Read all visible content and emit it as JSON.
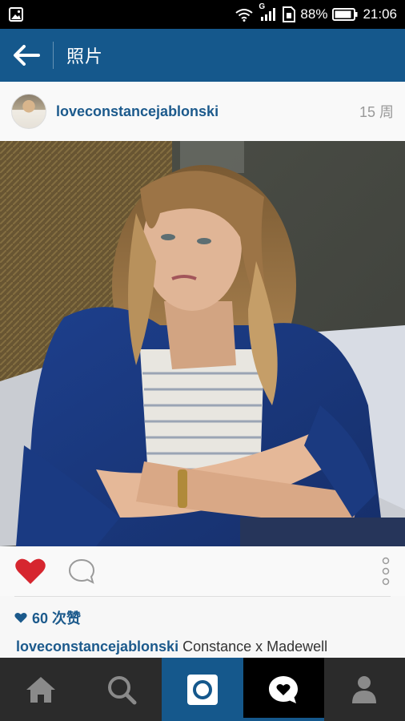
{
  "status_bar": {
    "battery": "88%",
    "time": "21:06",
    "network_label": "G"
  },
  "header": {
    "title": "照片",
    "back_icon": "arrow-left-icon"
  },
  "post": {
    "username": "loveconstancejablonski",
    "time_ago": "15 周",
    "likes": "60 次赞",
    "caption_user": "loveconstancejablonski",
    "caption_text": " Constance x Madewell",
    "liked": true
  },
  "nav": {
    "items": [
      "home-icon",
      "search-icon",
      "camera-icon",
      "activity-icon",
      "profile-icon"
    ],
    "active": "activity"
  },
  "colors": {
    "brand_blue": "#15588c",
    "link_blue": "#1c5a8c",
    "heart_red": "#d6262f",
    "nav_bg": "#2b2b2b"
  }
}
